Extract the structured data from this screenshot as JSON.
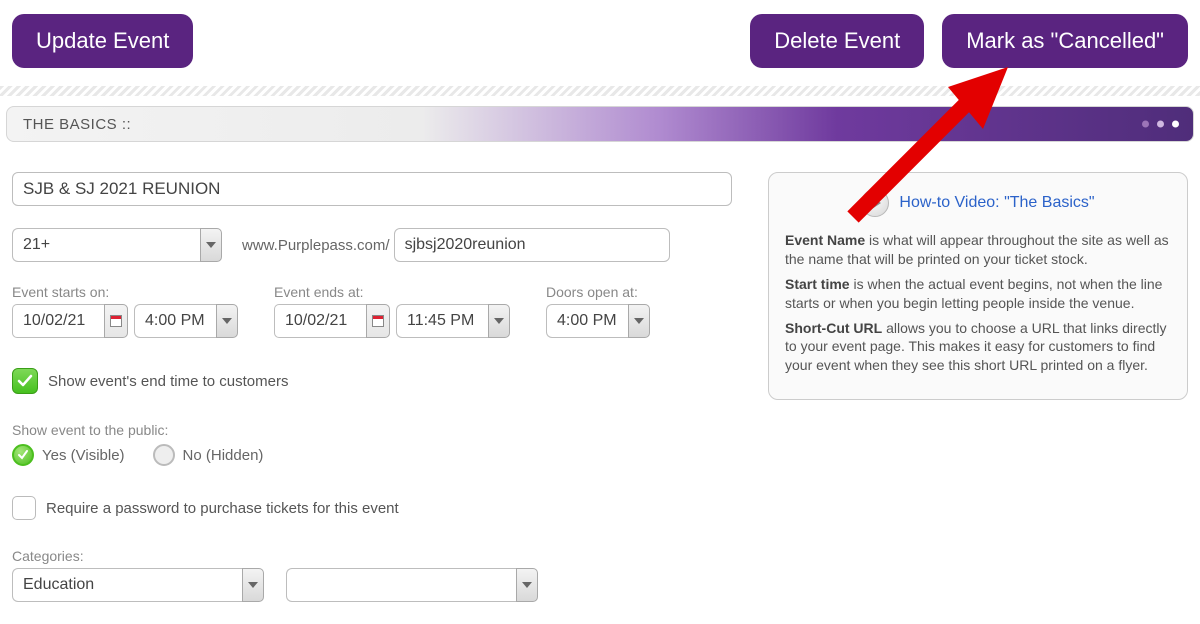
{
  "header": {
    "update_label": "Update Event",
    "delete_label": "Delete Event",
    "cancel_label": "Mark as \"Cancelled\""
  },
  "section": {
    "title": "THE BASICS ::"
  },
  "form": {
    "event_name": "SJB & SJ 2021 REUNION",
    "age_restriction": "21+",
    "url_prefix": "www.Purplepass.com/",
    "url_slug": "sjbsj2020reunion",
    "start": {
      "label": "Event starts on:",
      "date": "10/02/21",
      "time": "4:00 PM"
    },
    "end": {
      "label": "Event ends at:",
      "date": "10/02/21",
      "time": "11:45 PM"
    },
    "doors": {
      "label": "Doors open at:",
      "time": "4:00 PM"
    },
    "show_end_time_label": "Show event's end time to customers",
    "visibility": {
      "label": "Show event to the public:",
      "yes": "Yes (Visible)",
      "no": "No (Hidden)"
    },
    "password_label": "Require a password to purchase tickets for this event",
    "categories_label": "Categories:",
    "category_1": "Education",
    "category_2": ""
  },
  "help": {
    "video_label": "How-to Video: \"The Basics\"",
    "p1a": "Event Name",
    "p1b": " is what will appear throughout the site as well as the name that will be printed on your ticket stock.",
    "p2a": "Start time",
    "p2b": " is when the actual event begins, not when the line starts or when you begin letting people inside the venue.",
    "p3a": "Short-Cut URL",
    "p3b": " allows you to choose a URL that links directly to your event page. This makes it easy for customers to find your event when they see this short URL printed on a flyer."
  }
}
